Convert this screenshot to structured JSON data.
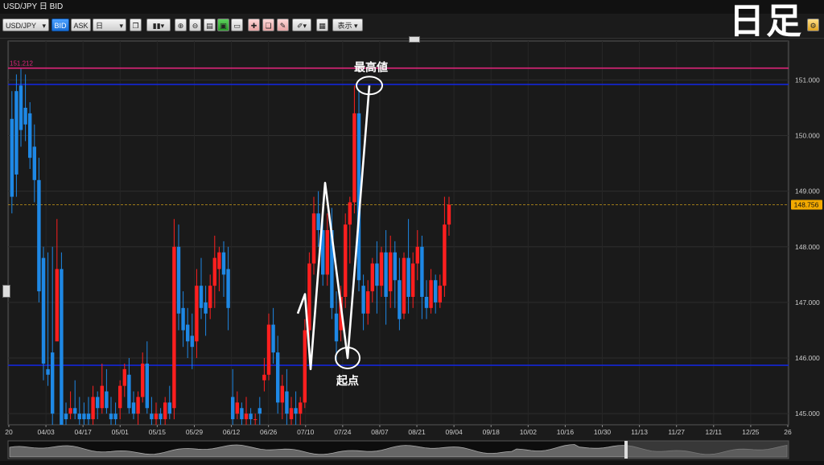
{
  "window": {
    "title": "USD/JPY 日 BID"
  },
  "toolbar": {
    "symbol": "USD/JPY",
    "bid_label": "BID",
    "ask_label": "ASK",
    "timeframe": "日",
    "display_label": "表示"
  },
  "overlay_label": "日足",
  "chart_data": {
    "type": "candlestick",
    "title": "",
    "symbol": "USD/JPY",
    "price_type": "BID",
    "timeframe": "日",
    "ylim": [
      144.8,
      151.7
    ],
    "y_ticks": [
      "145.000",
      "146.000",
      "147.000",
      "148.000",
      "149.000",
      "150.000",
      "151.000"
    ],
    "x_ticks": [
      "20",
      "04/03",
      "04/17",
      "05/01",
      "05/15",
      "05/29",
      "06/12",
      "06/26",
      "07/10",
      "07/24",
      "08/07",
      "08/21",
      "09/04",
      "09/18",
      "10/02",
      "10/16",
      "10/30",
      "11/13",
      "11/27",
      "12/11",
      "12/25",
      "26"
    ],
    "current_price": "148.756",
    "up_color": "#ff1f1f",
    "down_color": "#1e88e5",
    "hlines": [
      {
        "label": "151.212",
        "value": 151.212,
        "color": "#e0247a"
      },
      {
        "label": "",
        "value": 150.92,
        "color": "#1326d8"
      },
      {
        "label": "",
        "value": 145.87,
        "color": "#1326d8"
      }
    ],
    "annotations": [
      {
        "text": "最高値",
        "note": "high point",
        "value": 150.9
      },
      {
        "text": "起点",
        "note": "start point",
        "value": 145.9
      }
    ],
    "zigzag": [
      146.8,
      147.15,
      145.8,
      149.15,
      146.0,
      150.9
    ],
    "candles": [
      [
        150.3,
        150.8,
        148.9,
        148.6
      ],
      [
        150.8,
        151.1,
        149.3,
        148.9
      ],
      [
        150.9,
        151.2,
        150.1,
        149.8
      ],
      [
        150.5,
        151.1,
        150.2,
        149.9
      ],
      [
        150.4,
        150.6,
        149.6,
        149.4
      ],
      [
        149.8,
        150.2,
        149.2,
        148.8
      ],
      [
        149.2,
        149.6,
        147.2,
        147.0
      ],
      [
        147.8,
        148.0,
        145.9,
        145.6
      ],
      [
        145.8,
        147.9,
        145.7,
        145.5
      ],
      [
        146.1,
        148.0,
        145.0,
        144.8
      ],
      [
        146.3,
        148.5,
        147.6,
        147.0
      ],
      [
        147.6,
        147.9,
        144.8,
        144.6
      ],
      [
        145.0,
        145.2,
        144.9,
        144.8
      ],
      [
        145.0,
        145.4,
        145.1,
        144.9
      ],
      [
        145.1,
        145.6,
        145.0,
        144.9
      ],
      [
        145.0,
        145.3,
        144.9,
        144.8
      ],
      [
        145.0,
        145.2,
        144.9,
        144.7
      ],
      [
        145.0,
        145.3,
        144.9,
        144.8
      ],
      [
        144.9,
        145.5,
        145.3,
        144.8
      ],
      [
        145.3,
        145.4,
        145.1,
        144.9
      ],
      [
        145.1,
        145.9,
        145.5,
        145.0
      ],
      [
        145.4,
        145.8,
        145.1,
        145.0
      ],
      [
        145.0,
        145.3,
        144.9,
        144.8
      ],
      [
        145.0,
        145.2,
        144.9,
        144.7
      ],
      [
        145.1,
        145.6,
        145.5,
        144.9
      ],
      [
        145.5,
        145.9,
        145.8,
        145.3
      ],
      [
        145.7,
        146.0,
        145.1,
        145.0
      ],
      [
        145.2,
        145.4,
        145.0,
        144.9
      ],
      [
        145.0,
        145.4,
        145.3,
        144.8
      ],
      [
        145.3,
        146.1,
        145.9,
        145.2
      ],
      [
        145.9,
        146.3,
        145.1,
        145.0
      ],
      [
        145.0,
        145.3,
        144.9,
        144.8
      ],
      [
        144.9,
        145.2,
        145.0,
        144.7
      ],
      [
        145.0,
        145.1,
        144.9,
        144.8
      ],
      [
        144.9,
        145.3,
        145.2,
        144.8
      ],
      [
        145.2,
        145.5,
        145.0,
        144.9
      ],
      [
        145.1,
        148.5,
        148.0,
        144.9
      ],
      [
        148.0,
        148.4,
        146.8,
        146.5
      ],
      [
        146.9,
        147.2,
        146.5,
        146.2
      ],
      [
        146.6,
        146.9,
        146.3,
        146.0
      ],
      [
        146.4,
        146.8,
        146.2,
        145.8
      ],
      [
        146.3,
        147.6,
        147.3,
        146.0
      ],
      [
        147.3,
        147.8,
        146.9,
        146.7
      ],
      [
        147.0,
        147.3,
        146.8,
        146.4
      ],
      [
        146.9,
        147.5,
        147.3,
        146.7
      ],
      [
        147.3,
        148.2,
        147.8,
        146.9
      ],
      [
        147.6,
        148.0,
        147.9,
        147.2
      ],
      [
        147.9,
        148.1,
        147.5,
        147.1
      ],
      [
        147.6,
        148.0,
        146.9,
        146.5
      ],
      [
        145.3,
        145.8,
        144.9,
        144.8
      ],
      [
        145.0,
        145.4,
        145.2,
        144.9
      ],
      [
        145.1,
        145.2,
        144.9,
        144.8
      ],
      [
        144.9,
        145.3,
        145.0,
        144.8
      ],
      [
        145.0,
        145.1,
        144.9,
        144.7
      ],
      [
        144.9,
        145.0,
        144.9,
        144.8
      ],
      [
        145.1,
        145.3,
        145.0,
        144.8
      ],
      [
        145.6,
        146.0,
        145.7,
        145.4
      ],
      [
        145.7,
        146.8,
        146.6,
        145.6
      ],
      [
        146.6,
        146.9,
        146.1,
        145.9
      ],
      [
        146.1,
        146.4,
        145.2,
        145.0
      ],
      [
        145.2,
        145.7,
        145.5,
        144.9
      ],
      [
        145.4,
        145.8,
        145.0,
        144.8
      ],
      [
        144.9,
        145.3,
        145.1,
        144.8
      ],
      [
        145.1,
        145.4,
        145.0,
        144.8
      ],
      [
        145.0,
        145.3,
        145.2,
        144.8
      ],
      [
        145.2,
        146.7,
        146.5,
        145.1
      ],
      [
        146.5,
        147.9,
        147.7,
        146.3
      ],
      [
        147.7,
        148.9,
        148.6,
        147.5
      ],
      [
        148.6,
        149.0,
        148.3,
        148.0
      ],
      [
        148.3,
        148.8,
        147.5,
        147.3
      ],
      [
        147.5,
        148.6,
        148.3,
        147.3
      ],
      [
        148.3,
        148.7,
        146.9,
        146.7
      ],
      [
        146.8,
        147.2,
        146.3,
        145.9
      ],
      [
        146.5,
        147.3,
        147.1,
        146.3
      ],
      [
        147.1,
        148.6,
        148.4,
        146.9
      ],
      [
        148.4,
        148.9,
        148.8,
        147.7
      ],
      [
        148.8,
        150.9,
        150.4,
        148.6
      ],
      [
        150.4,
        150.8,
        147.4,
        147.2
      ],
      [
        147.3,
        147.5,
        146.8,
        146.5
      ],
      [
        146.8,
        147.4,
        147.2,
        146.6
      ],
      [
        147.2,
        147.8,
        147.7,
        147.0
      ],
      [
        147.7,
        148.1,
        147.3,
        146.8
      ],
      [
        147.3,
        148.0,
        147.9,
        147.1
      ],
      [
        147.9,
        148.3,
        147.1,
        146.6
      ],
      [
        147.2,
        148.2,
        147.9,
        146.9
      ],
      [
        147.9,
        148.1,
        147.4,
        146.9
      ],
      [
        147.4,
        147.8,
        146.7,
        146.5
      ],
      [
        146.8,
        147.9,
        147.8,
        146.7
      ],
      [
        147.8,
        148.5,
        147.1,
        146.8
      ],
      [
        147.1,
        147.9,
        147.7,
        146.9
      ],
      [
        147.7,
        148.3,
        148.0,
        147.4
      ],
      [
        148.0,
        148.2,
        147.1,
        146.7
      ],
      [
        147.1,
        147.4,
        146.9,
        146.7
      ],
      [
        146.9,
        147.6,
        147.4,
        146.8
      ],
      [
        147.4,
        147.5,
        147.0,
        146.8
      ],
      [
        147.0,
        147.5,
        147.3,
        146.9
      ],
      [
        147.3,
        148.9,
        148.4,
        147.1
      ],
      [
        148.4,
        148.9,
        148.756,
        148.2
      ]
    ]
  }
}
